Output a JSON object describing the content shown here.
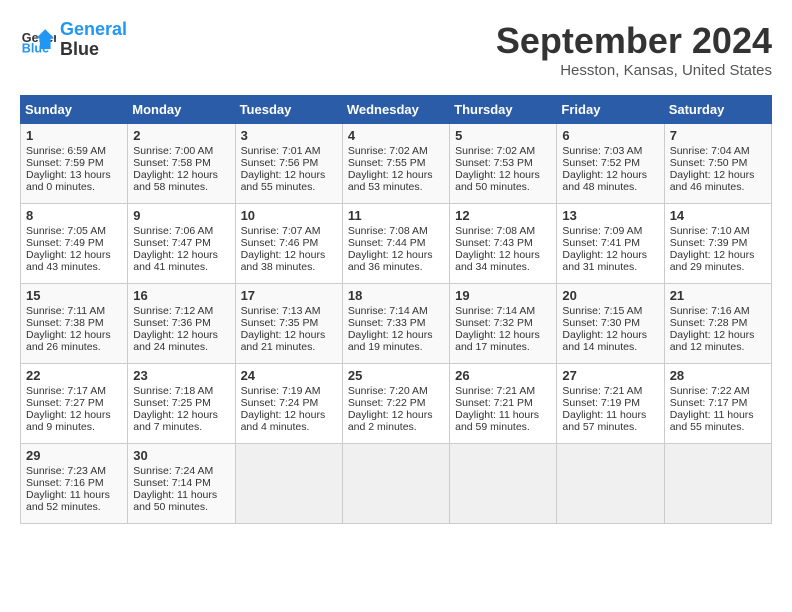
{
  "logo": {
    "line1": "General",
    "line2": "Blue"
  },
  "title": "September 2024",
  "subtitle": "Hesston, Kansas, United States",
  "days_of_week": [
    "Sunday",
    "Monday",
    "Tuesday",
    "Wednesday",
    "Thursday",
    "Friday",
    "Saturday"
  ],
  "weeks": [
    [
      {
        "day": "1",
        "sunrise": "6:59 AM",
        "sunset": "7:59 PM",
        "daylight": "13 hours and 0 minutes."
      },
      {
        "day": "2",
        "sunrise": "7:00 AM",
        "sunset": "7:58 PM",
        "daylight": "12 hours and 58 minutes."
      },
      {
        "day": "3",
        "sunrise": "7:01 AM",
        "sunset": "7:56 PM",
        "daylight": "12 hours and 55 minutes."
      },
      {
        "day": "4",
        "sunrise": "7:02 AM",
        "sunset": "7:55 PM",
        "daylight": "12 hours and 53 minutes."
      },
      {
        "day": "5",
        "sunrise": "7:02 AM",
        "sunset": "7:53 PM",
        "daylight": "12 hours and 50 minutes."
      },
      {
        "day": "6",
        "sunrise": "7:03 AM",
        "sunset": "7:52 PM",
        "daylight": "12 hours and 48 minutes."
      },
      {
        "day": "7",
        "sunrise": "7:04 AM",
        "sunset": "7:50 PM",
        "daylight": "12 hours and 46 minutes."
      }
    ],
    [
      {
        "day": "8",
        "sunrise": "7:05 AM",
        "sunset": "7:49 PM",
        "daylight": "12 hours and 43 minutes."
      },
      {
        "day": "9",
        "sunrise": "7:06 AM",
        "sunset": "7:47 PM",
        "daylight": "12 hours and 41 minutes."
      },
      {
        "day": "10",
        "sunrise": "7:07 AM",
        "sunset": "7:46 PM",
        "daylight": "12 hours and 38 minutes."
      },
      {
        "day": "11",
        "sunrise": "7:08 AM",
        "sunset": "7:44 PM",
        "daylight": "12 hours and 36 minutes."
      },
      {
        "day": "12",
        "sunrise": "7:08 AM",
        "sunset": "7:43 PM",
        "daylight": "12 hours and 34 minutes."
      },
      {
        "day": "13",
        "sunrise": "7:09 AM",
        "sunset": "7:41 PM",
        "daylight": "12 hours and 31 minutes."
      },
      {
        "day": "14",
        "sunrise": "7:10 AM",
        "sunset": "7:39 PM",
        "daylight": "12 hours and 29 minutes."
      }
    ],
    [
      {
        "day": "15",
        "sunrise": "7:11 AM",
        "sunset": "7:38 PM",
        "daylight": "12 hours and 26 minutes."
      },
      {
        "day": "16",
        "sunrise": "7:12 AM",
        "sunset": "7:36 PM",
        "daylight": "12 hours and 24 minutes."
      },
      {
        "day": "17",
        "sunrise": "7:13 AM",
        "sunset": "7:35 PM",
        "daylight": "12 hours and 21 minutes."
      },
      {
        "day": "18",
        "sunrise": "7:14 AM",
        "sunset": "7:33 PM",
        "daylight": "12 hours and 19 minutes."
      },
      {
        "day": "19",
        "sunrise": "7:14 AM",
        "sunset": "7:32 PM",
        "daylight": "12 hours and 17 minutes."
      },
      {
        "day": "20",
        "sunrise": "7:15 AM",
        "sunset": "7:30 PM",
        "daylight": "12 hours and 14 minutes."
      },
      {
        "day": "21",
        "sunrise": "7:16 AM",
        "sunset": "7:28 PM",
        "daylight": "12 hours and 12 minutes."
      }
    ],
    [
      {
        "day": "22",
        "sunrise": "7:17 AM",
        "sunset": "7:27 PM",
        "daylight": "12 hours and 9 minutes."
      },
      {
        "day": "23",
        "sunrise": "7:18 AM",
        "sunset": "7:25 PM",
        "daylight": "12 hours and 7 minutes."
      },
      {
        "day": "24",
        "sunrise": "7:19 AM",
        "sunset": "7:24 PM",
        "daylight": "12 hours and 4 minutes."
      },
      {
        "day": "25",
        "sunrise": "7:20 AM",
        "sunset": "7:22 PM",
        "daylight": "12 hours and 2 minutes."
      },
      {
        "day": "26",
        "sunrise": "7:21 AM",
        "sunset": "7:21 PM",
        "daylight": "11 hours and 59 minutes."
      },
      {
        "day": "27",
        "sunrise": "7:21 AM",
        "sunset": "7:19 PM",
        "daylight": "11 hours and 57 minutes."
      },
      {
        "day": "28",
        "sunrise": "7:22 AM",
        "sunset": "7:17 PM",
        "daylight": "11 hours and 55 minutes."
      }
    ],
    [
      {
        "day": "29",
        "sunrise": "7:23 AM",
        "sunset": "7:16 PM",
        "daylight": "11 hours and 52 minutes."
      },
      {
        "day": "30",
        "sunrise": "7:24 AM",
        "sunset": "7:14 PM",
        "daylight": "11 hours and 50 minutes."
      },
      null,
      null,
      null,
      null,
      null
    ]
  ]
}
